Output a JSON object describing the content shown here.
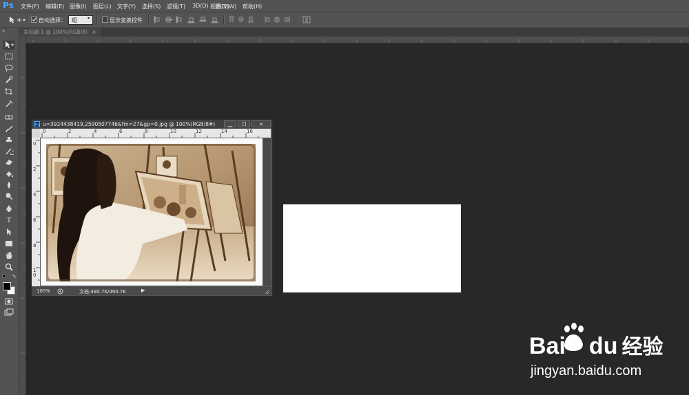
{
  "app": {
    "logo": "Ps"
  },
  "menu": [
    "文件(F)",
    "编辑(E)",
    "图像(I)",
    "图层(L)",
    "文字(Y)",
    "选择(S)",
    "滤镜(T)",
    "3D(D)",
    "视图(V)",
    "窗口(W)",
    "帮助(H)"
  ],
  "options": {
    "auto_select_label": "自动选择：",
    "auto_select_value": "组",
    "transform_label": "显示变换控件"
  },
  "tabs": {
    "doc_tab": "未标题-1 @ 100%(RGB/8)"
  },
  "docwin": {
    "title": "u=3924438419,2590507746&fm=27&gp=0.jpg @ 100%(RGB/8#)",
    "min": "▁",
    "restore": "❐",
    "close": "✕",
    "hruler_ticks": [
      "0",
      "2",
      "4",
      "6",
      "8",
      "10",
      "12",
      "14",
      "16"
    ],
    "vruler_ticks": [
      "0",
      "2",
      "4",
      "6",
      "8",
      "1 0"
    ],
    "zoom": "100%",
    "doc_info": "文档:490.7K/490.7K"
  },
  "colors": {
    "accent": "#4ea5ff",
    "workspace": "#282828",
    "panel": "#535353"
  },
  "watermark": {
    "brand": "Bai",
    "brand2": "du",
    "cn": "经验",
    "url": "jingyan.baidu.com"
  }
}
